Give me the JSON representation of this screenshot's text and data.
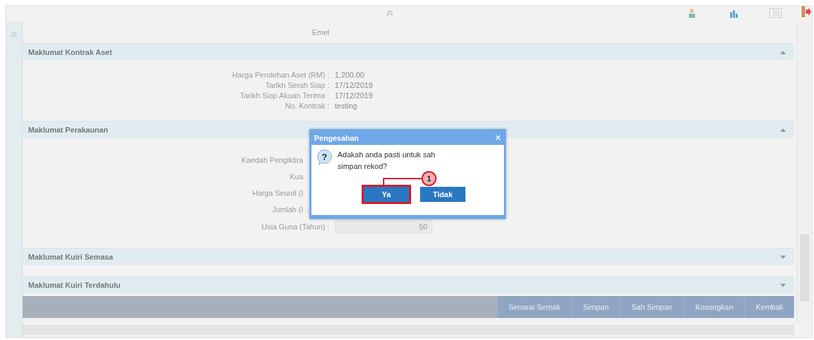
{
  "top_field": {
    "label": "Emel"
  },
  "sections": [
    {
      "title": "Maklumat Kontrak Aset",
      "expanded": true,
      "fields": [
        {
          "kind": "text",
          "label": "Harga Perolehan Aset (RM) :",
          "value": "1,200.00"
        },
        {
          "kind": "text",
          "label": "Tarikh Serah Siap :",
          "value": "17/12/2019"
        },
        {
          "kind": "text",
          "label": "Tarikh Siap Akuan Terima :",
          "value": "17/12/2019"
        },
        {
          "kind": "text",
          "label": "No. Kontrak :",
          "value": "testing"
        }
      ]
    },
    {
      "title": "Maklumat Perakaunan",
      "expanded": true,
      "fields": [
        {
          "kind": "hidden",
          "label": "Kaedah Pengiktira"
        },
        {
          "kind": "hidden",
          "label": "Kua"
        },
        {
          "kind": "hidden",
          "label": "Harga Seunit (I"
        },
        {
          "kind": "hidden",
          "label": "Jumlah (I"
        },
        {
          "kind": "input",
          "label": "Usia Guna (Tahun) :",
          "value": "50"
        }
      ]
    },
    {
      "title": "Maklumat Kuiri Semasa",
      "expanded": false
    },
    {
      "title": "Maklumat Kuiri Terdahulu",
      "expanded": false
    }
  ],
  "actions": [
    "Senarai Semak",
    "Simpan",
    "Sah Simpan",
    "Kosongkan",
    "Kembali"
  ],
  "dialog": {
    "title": "Pengesahan",
    "close": "×",
    "icon": "?",
    "message": "Adakah anda pasti untuk sah simpan rekod?",
    "buttons": [
      {
        "label": "Ya",
        "highlighted": true
      },
      {
        "label": "Tidak",
        "highlighted": false
      }
    ],
    "callout": "1"
  }
}
